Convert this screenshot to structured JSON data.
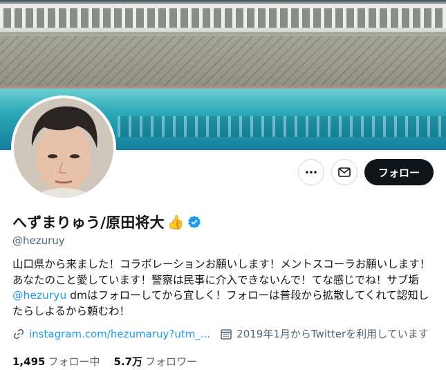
{
  "profile": {
    "display_name": "へずまりゅう/原田将大",
    "name_emoji": "👍",
    "verified_icon": "verified-badge-icon",
    "handle": "@hezuruy",
    "bio_part1": "山口県から来ました！コラボレーションお願いします！メントスコーラお願いします！あなたのこと愛しています！警察は民事に介入できないんで！てな感じでね！サブ垢",
    "bio_mention": "@hezuryu",
    "bio_part2": " dmはフォローしてから宜しく！フォローは普段から拡散してくれて認知したらしよるから頼むわ！",
    "link_text": "instagram.com/hezumaruy?utm_...",
    "joined_text": "2019年1月からTwitterを利用しています",
    "following_count": "1,495",
    "following_label": "フォロー中",
    "followers_count": "5.7万",
    "followers_label": "フォロワー"
  },
  "actions": {
    "more_icon": "more-horizontal-icon",
    "message_icon": "mail-icon",
    "follow_label": "フォロー"
  },
  "colors": {
    "accent": "#1d9bf0",
    "text": "#0f1419",
    "secondary": "#536471",
    "button_dark": "#0f1419"
  }
}
